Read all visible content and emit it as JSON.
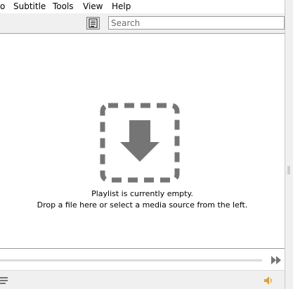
{
  "menu": {
    "items": [
      {
        "label": "o"
      },
      {
        "label": "Subtitle"
      },
      {
        "label": "Tools"
      },
      {
        "label": "View"
      },
      {
        "label": "Help"
      }
    ]
  },
  "toolbar": {
    "search_placeholder": "Search",
    "view_mode_icon": "list-view-icon"
  },
  "playlist": {
    "empty_message_line1": "Playlist is currently empty.",
    "empty_message_line2": "Drop a file here or select a media source from the left.",
    "drop_icon": "download-arrow-icon"
  },
  "controls": {
    "fast_forward_icon": "fast-forward-icon",
    "playlist_icon": "playlist-toggle-icon",
    "volume_icon": "volume-icon"
  },
  "colors": {
    "icon_gray": "#757575",
    "toolbar_bg": "#f0f0f0",
    "border": "#a0a0a0"
  }
}
